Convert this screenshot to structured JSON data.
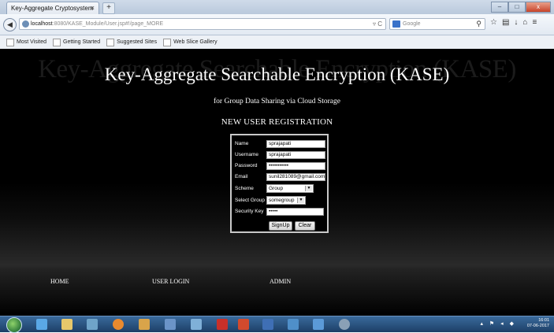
{
  "browser": {
    "tab_title": "Key-Aggregate Cryptosystem",
    "tab_close": "×",
    "new_tab": "+",
    "url_host": "localhost",
    "url_path": ":8080/KASE_Module/User.jsp#!/page_MORE",
    "search_placeholder": "Google",
    "window_buttons": [
      "–",
      "□",
      "x"
    ]
  },
  "bookmarks": [
    "Most Visited",
    "Getting Started",
    "Suggested Sites",
    "Web Slice Gallery"
  ],
  "page": {
    "ghost_title": "Key-Aggregate Searchable Encryption (KASE)",
    "title": "Key-Aggregate Searchable Encryption (KASE)",
    "subtitle": "for Group Data Sharing via Cloud Storage",
    "section_title": "NEW USER REGISTRATION"
  },
  "form": {
    "name_label": "Name",
    "name_value": "sprajapati",
    "username_label": "Username",
    "username_value": "sprajapati",
    "password_label": "Password",
    "password_value": "•••••••••••",
    "email_label": "Email",
    "email_value": "sunil281089@gmail.com",
    "scheme_label": "Scheme",
    "scheme_value": "Group",
    "group_label": "Select Group",
    "group_value": "somegroup",
    "key_label": "Security Key",
    "key_value": "•••••",
    "signup_label": "SignUp",
    "clear_label": "Clear"
  },
  "menu": {
    "home": "HOME",
    "user_login": "USER LOGIN",
    "admin": "ADMIN"
  },
  "taskbar": {
    "time": "16:01",
    "date": "07-06-2017"
  }
}
